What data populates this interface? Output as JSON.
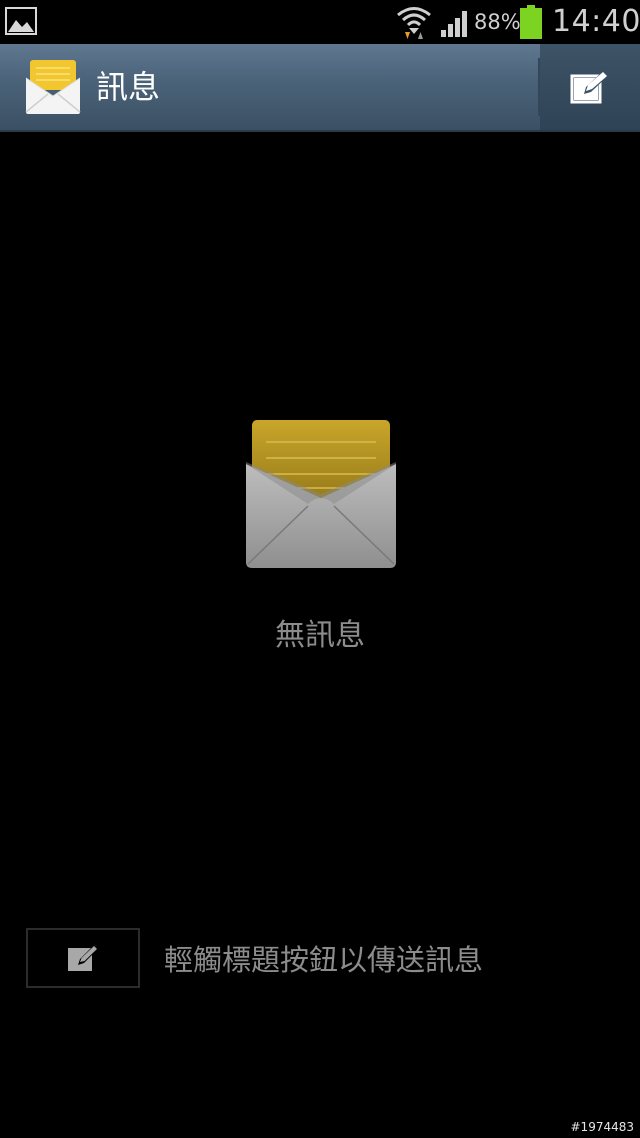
{
  "status_bar": {
    "battery_percent": "88%",
    "time": "14:40",
    "icons": [
      "gallery-icon",
      "wifi-icon",
      "signal-icon",
      "battery-icon"
    ],
    "battery_color": "#7dd321"
  },
  "action_bar": {
    "title": "訊息",
    "icons": [
      "messages-app-icon",
      "compose-icon"
    ]
  },
  "empty_state": {
    "text": "無訊息",
    "icon": "empty-envelope-icon"
  },
  "hint": {
    "text": "輕觸標題按鈕以傳送訊息",
    "icon": "compose-icon"
  },
  "watermark": "#1974483",
  "colors": {
    "action_bar_top": "#5f7890",
    "action_bar_bottom": "#3b5064",
    "envelope_gold": "#c9a62a",
    "envelope_gray": "#a8a8a8",
    "muted_text": "#8c8c8c"
  }
}
